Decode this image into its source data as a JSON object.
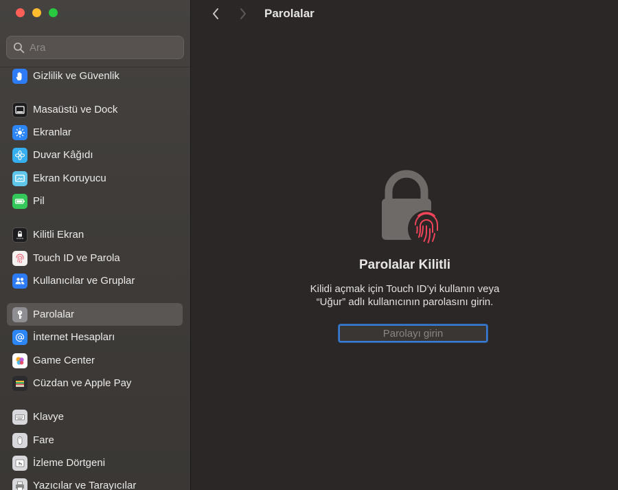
{
  "search": {
    "placeholder": "Ara"
  },
  "sidebar": {
    "items": [
      {
        "label": "Gizlilik ve Güvenlik",
        "icon": "hand-icon",
        "color": "#2d7cf6"
      },
      {
        "label": "Masaüstü ve Dock",
        "icon": "dock-icon",
        "color": "#1c1c1e"
      },
      {
        "label": "Ekranlar",
        "icon": "sun-icon",
        "color": "#2d86f6"
      },
      {
        "label": "Duvar Kâğıdı",
        "icon": "flower-icon",
        "color": "#36aff0"
      },
      {
        "label": "Ekran Koruyucu",
        "icon": "screensaver-icon",
        "color": "#5fc6ea"
      },
      {
        "label": "Pil",
        "icon": "battery-icon",
        "color": "#34c759"
      },
      {
        "label": "Kilitli Ekran",
        "icon": "lock-screen-icon",
        "color": "#1c1c1e"
      },
      {
        "label": "Touch ID ve Parola",
        "icon": "fingerprint-icon",
        "color": "#f5f2f2"
      },
      {
        "label": "Kullanıcılar ve Gruplar",
        "icon": "users-icon",
        "color": "#2d7cf6"
      },
      {
        "label": "Parolalar",
        "icon": "key-icon",
        "color": "#8e8e93"
      },
      {
        "label": "İnternet Hesapları",
        "icon": "at-sign-icon",
        "color": "#2d86f6"
      },
      {
        "label": "Game Center",
        "icon": "game-center-icon",
        "color": "#ffffff"
      },
      {
        "label": "Cüzdan ve Apple Pay",
        "icon": "wallet-icon",
        "color": "#2c2c2e"
      },
      {
        "label": "Klavye",
        "icon": "keyboard-icon",
        "color": "#d8d8dc"
      },
      {
        "label": "Fare",
        "icon": "mouse-icon",
        "color": "#d8d8dc"
      },
      {
        "label": "İzleme Dörtgeni",
        "icon": "trackpad-icon",
        "color": "#d8d8dc"
      },
      {
        "label": "Yazıcılar ve Tarayıcılar",
        "icon": "printer-icon",
        "color": "#d8d8dc"
      }
    ],
    "selected": "Parolalar"
  },
  "toolbar": {
    "title": "Parolalar",
    "back_icon": "chevron-left-icon",
    "forward_icon": "chevron-right-icon"
  },
  "content": {
    "title": "Parolalar Kilitli",
    "desc_line1": "Kilidi açmak için Touch ID’yi kullanın veya",
    "desc_line2": "“Uğur” adlı kullanıcının parolasını girin.",
    "password_placeholder": "Parolayı girin"
  },
  "colors": {
    "accent": "#3a7bd5",
    "fingerprint": "#f0445a"
  }
}
